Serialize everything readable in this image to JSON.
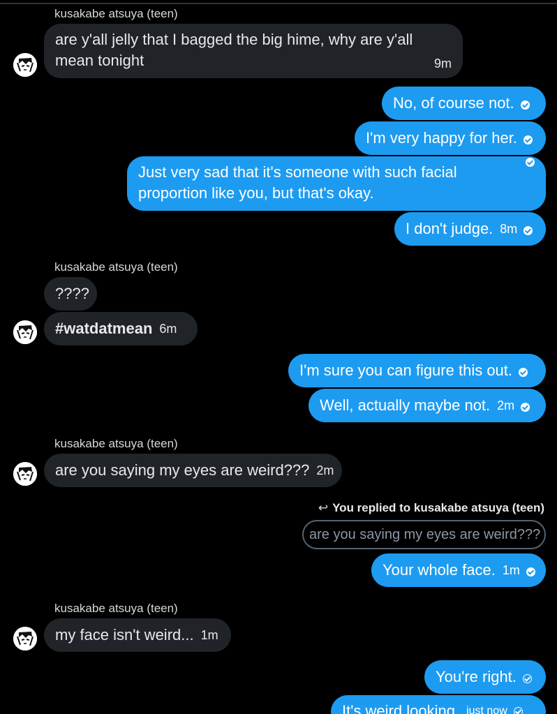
{
  "contact": {
    "name": "kusakabe atsuya (teen)"
  },
  "reply_preview": {
    "label": "You replied to kusakabe atsuya (teen)",
    "quoted": "are you saying my eyes are weird???"
  },
  "messages": [
    {
      "id": "m1",
      "sender": "them",
      "text": "are y'all jelly that I bagged the big hime, why are y'all mean tonight",
      "line1": "are y'all jelly that I bagged the big hime, why are y'all",
      "line2": "mean tonight",
      "time": "9m"
    },
    {
      "id": "m2",
      "sender": "me",
      "text": "No, of course not.",
      "status": "seen"
    },
    {
      "id": "m3",
      "sender": "me",
      "text": "I'm very happy for her.",
      "status": "seen"
    },
    {
      "id": "m4",
      "sender": "me",
      "text": "Just very sad that it's someone with such facial proportion like you, but that's okay.",
      "line1": "Just very sad that it's someone with such facial",
      "line2": "proportion like you, but that's okay.",
      "status": "seen"
    },
    {
      "id": "m5",
      "sender": "me",
      "text": "I don't judge.",
      "time": "8m",
      "status": "seen"
    },
    {
      "id": "m6",
      "sender": "them",
      "text": "????"
    },
    {
      "id": "m7",
      "sender": "them",
      "text": "#watdatmean",
      "time": "6m"
    },
    {
      "id": "m8",
      "sender": "me",
      "text": "I'm sure you can figure this out.",
      "status": "seen"
    },
    {
      "id": "m9",
      "sender": "me",
      "text": "Well, actually maybe not.",
      "time": "2m",
      "status": "seen"
    },
    {
      "id": "m10",
      "sender": "them",
      "text": "are you saying my eyes are weird???",
      "time": "2m"
    },
    {
      "id": "m11",
      "sender": "me",
      "text": "Your whole face.",
      "time": "1m",
      "status": "seen"
    },
    {
      "id": "m12",
      "sender": "them",
      "text": "my face isn't weird...",
      "time": "1m"
    },
    {
      "id": "m13",
      "sender": "me",
      "text": "You're right.",
      "status": "sent"
    },
    {
      "id": "m14",
      "sender": "me",
      "text": "It's weird looking.",
      "time": "just now",
      "status": "sent"
    }
  ],
  "colors": {
    "background": "#000000",
    "incoming": "#202327",
    "outgoing": "#1d9bf0"
  }
}
